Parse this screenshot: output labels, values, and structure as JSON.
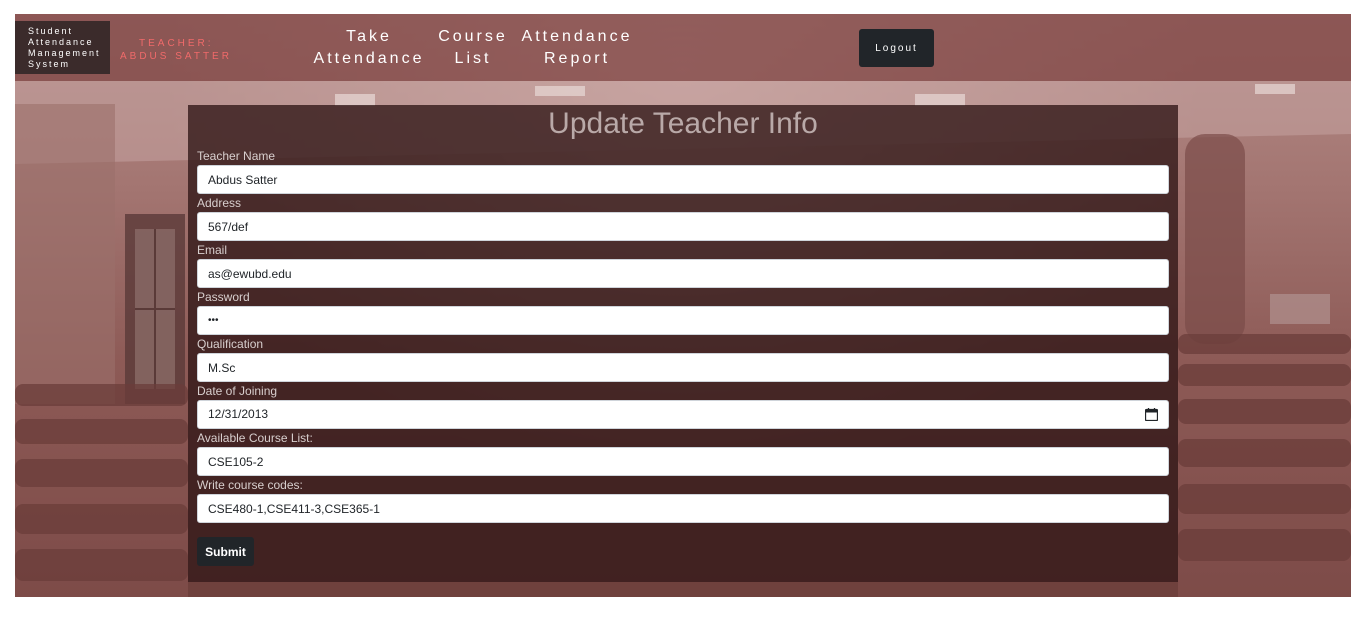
{
  "brand": {
    "lines": [
      "Student",
      "Attendance",
      "Management",
      "System"
    ]
  },
  "teacher_tag": {
    "line1": "TEACHER:",
    "line2": "ABDUS SATTER"
  },
  "nav": {
    "take_attendance": [
      "Take",
      "Attendance"
    ],
    "course_list": [
      "Course",
      "List"
    ],
    "attendance_report": [
      "Attendance",
      "Report"
    ],
    "logout_label": "Logout"
  },
  "form": {
    "title": "Update Teacher Info",
    "fields": [
      {
        "label": "Teacher Name",
        "value": "Abdus Satter"
      },
      {
        "label": "Address",
        "value": "567/def"
      },
      {
        "label": "Email",
        "value": "as@ewubd.edu"
      },
      {
        "label": "Password",
        "value": "•••"
      },
      {
        "label": "Qualification",
        "value": "M.Sc"
      },
      {
        "label": "Date of Joining",
        "value": "12/31/2013"
      },
      {
        "label": "Available Course List:",
        "value": "CSE105-2"
      },
      {
        "label": "Write course codes:",
        "value": "CSE480-1,CSE411-3,CSE365-1"
      }
    ],
    "submit_label": "Submit"
  },
  "icons": {
    "date_picker": "calendar-icon"
  },
  "colors": {
    "navbar": "#824846",
    "brand_bg": "#3b2b2b",
    "teacher_tag": "#f06a6a",
    "panel": "#301616",
    "button": "#212529"
  }
}
